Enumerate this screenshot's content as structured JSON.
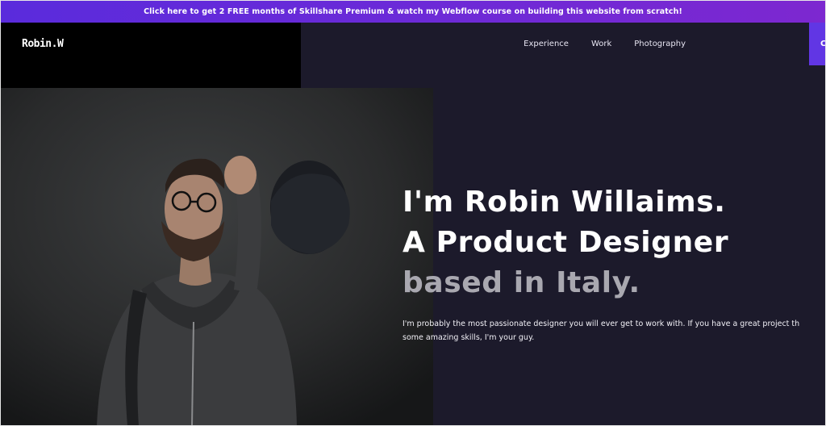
{
  "banner": {
    "text": "Click here to get 2 FREE months of Skillshare Premium & watch my Webflow course on building this website from scratch!"
  },
  "header": {
    "logo": "Robin.W",
    "nav": [
      {
        "label": "Experience"
      },
      {
        "label": "Work"
      },
      {
        "label": "Photography"
      }
    ],
    "cta_label": "C"
  },
  "hero": {
    "line1": "I'm Robin Willaims.",
    "line2": "A Product Designer",
    "line3": "based in Italy.",
    "para_line1": "I'm probably the most passionate designer you will ever get to work with. If you have a great project th",
    "para_line2": "some amazing skills, I'm your guy."
  },
  "colors": {
    "banner_start": "#5a2bdc",
    "banner_end": "#7d28d0",
    "background": "#1c1a2b",
    "accent": "#6136e4",
    "muted_text": "#a9a8b0"
  }
}
